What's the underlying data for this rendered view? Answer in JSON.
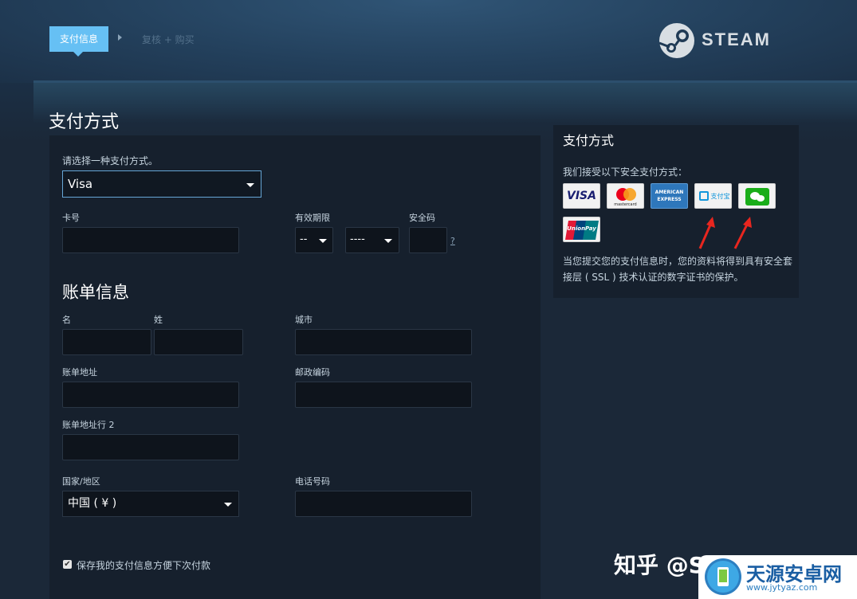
{
  "steps": {
    "active": "支付信息",
    "next": "复核 + 购买"
  },
  "brand": {
    "name": "STEAM"
  },
  "page_title": "支付方式",
  "payment": {
    "select_prompt": "请选择一种支付方式。",
    "method_selected": "Visa",
    "card_number_label": "卡号",
    "expiry_label": "有效期限",
    "expiry_month": "--",
    "expiry_year": "----",
    "cvv_label": "安全码",
    "cvv_help": "?"
  },
  "billing": {
    "title": "账单信息",
    "first_name_label": "名",
    "last_name_label": "姓",
    "city_label": "城市",
    "address_label": "账单地址",
    "postal_label": "邮政编码",
    "address2_label": "账单地址行 2",
    "country_label": "国家/地区",
    "country_selected": "中国 ( ¥ )",
    "phone_label": "电话号码",
    "save_label": "保存我的支付信息方便下次付款"
  },
  "side": {
    "title": "支付方式",
    "accept_text": "我们接受以下安全支付方式：",
    "methods": [
      "VISA",
      "mastercard",
      "AMERICAN EXPRESS",
      "支付宝",
      "微信支付",
      "UnionPay"
    ],
    "ssl_note": "当您提交您的支付信息时，您的资料将得到具有安全套接层 ( SSL ) 技术认证的数字证书的保护。"
  },
  "watermark": {
    "zhihu": "知乎 @S",
    "site_name": "天源安卓网",
    "site_url": "www.jytyaz.com"
  },
  "colors": {
    "accent": "#66c0f4",
    "panel": "#16202d",
    "input_bg": "#0e141c",
    "arrow_red": "#e8261f"
  }
}
